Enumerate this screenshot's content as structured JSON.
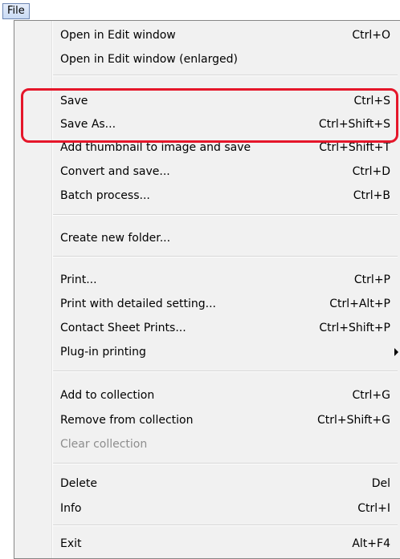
{
  "menu_bar": {
    "file_label": "File"
  },
  "menu": {
    "items": [
      {
        "label": "Open in Edit window",
        "shortcut": "Ctrl+O"
      },
      {
        "label": "Open in Edit window (enlarged)",
        "shortcut": ""
      },
      {
        "label": "Save",
        "shortcut": "Ctrl+S"
      },
      {
        "label": "Save As...",
        "shortcut": "Ctrl+Shift+S"
      },
      {
        "label": "Add thumbnail to image and save",
        "shortcut": "Ctrl+Shift+T"
      },
      {
        "label": "Convert and save...",
        "shortcut": "Ctrl+D"
      },
      {
        "label": "Batch process...",
        "shortcut": "Ctrl+B"
      },
      {
        "label": "Create new folder...",
        "shortcut": ""
      },
      {
        "label": "Print...",
        "shortcut": "Ctrl+P"
      },
      {
        "label": "Print with detailed setting...",
        "shortcut": "Ctrl+Alt+P"
      },
      {
        "label": "Contact Sheet Prints...",
        "shortcut": "Ctrl+Shift+P"
      },
      {
        "label": "Plug-in printing",
        "shortcut": "",
        "submenu": true
      },
      {
        "label": "Add to collection",
        "shortcut": "Ctrl+G"
      },
      {
        "label": "Remove from collection",
        "shortcut": "Ctrl+Shift+G"
      },
      {
        "label": "Clear collection",
        "shortcut": "",
        "disabled": true
      },
      {
        "label": "Delete",
        "shortcut": "Del"
      },
      {
        "label": "Info",
        "shortcut": "Ctrl+I"
      },
      {
        "label": "Exit",
        "shortcut": "Alt+F4"
      }
    ]
  },
  "colors": {
    "highlight_border": "#e5162a",
    "menu_background": "#f1f1f1"
  }
}
